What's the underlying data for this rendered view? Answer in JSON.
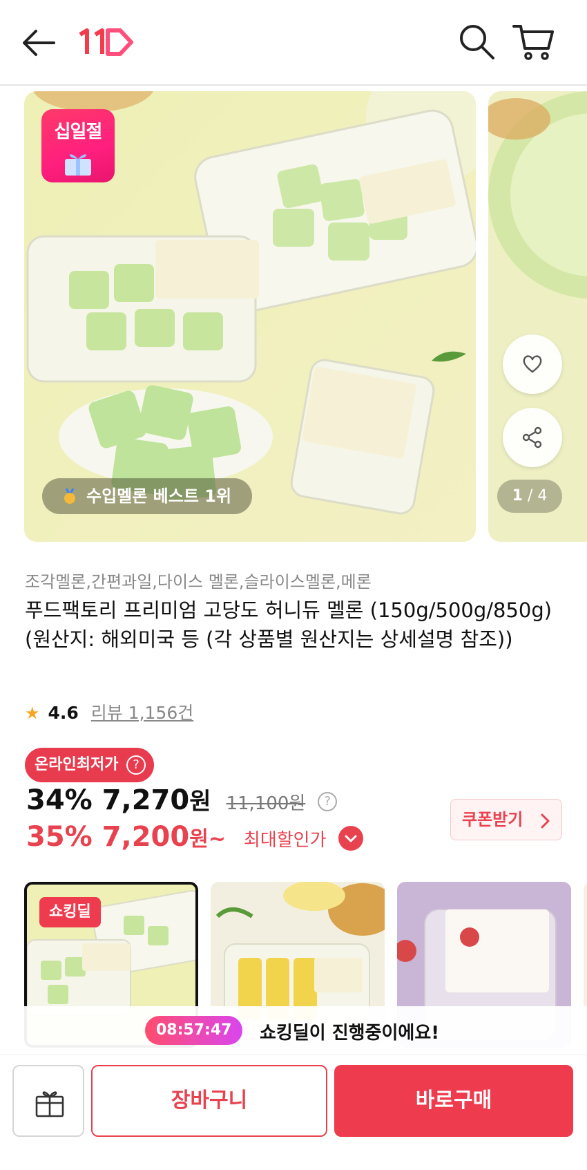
{
  "header": {
    "logo_text": "11",
    "icons": [
      "back-arrow-icon",
      "search-icon",
      "cart-icon"
    ],
    "brand_color": "#e8424f"
  },
  "gallery": {
    "festival_badge": "십일절",
    "best_label": "수입멜론 베스트 1위",
    "pager_current": "1",
    "pager_total": "/ 4",
    "icons": [
      "heart-icon",
      "share-icon",
      "medal-icon"
    ]
  },
  "product": {
    "tags": "조각멜론,간편과일,다이스 멜론,슬라이스멜론,메론",
    "title": "푸드팩토리 프리미엄 고당도 허니듀 멜론 (150g/500g/850g) (원산지: 해외미국 등 (각 상품별 원산지는 상세설명 참조))",
    "rating": "4.6",
    "reviews": "리뷰 1,156건"
  },
  "price": {
    "lowest_badge": "온라인최저가",
    "discount1": "34%",
    "price1": "7,270",
    "won": "원",
    "original": "11,100원",
    "discount2": "35%",
    "price2": "7,200",
    "won_from": "원~",
    "max_discount_label": "최대할인가",
    "coupon_label": "쿠폰받기"
  },
  "options": {
    "shocking_badge": "쇼킹딜"
  },
  "deal": {
    "timer": "08:57:47",
    "message": "쇼킹딜이 진행중이에요!"
  },
  "bottom": {
    "cart_label": "장바구니",
    "buy_label": "바로구매",
    "gift_icon": "gift-icon"
  }
}
